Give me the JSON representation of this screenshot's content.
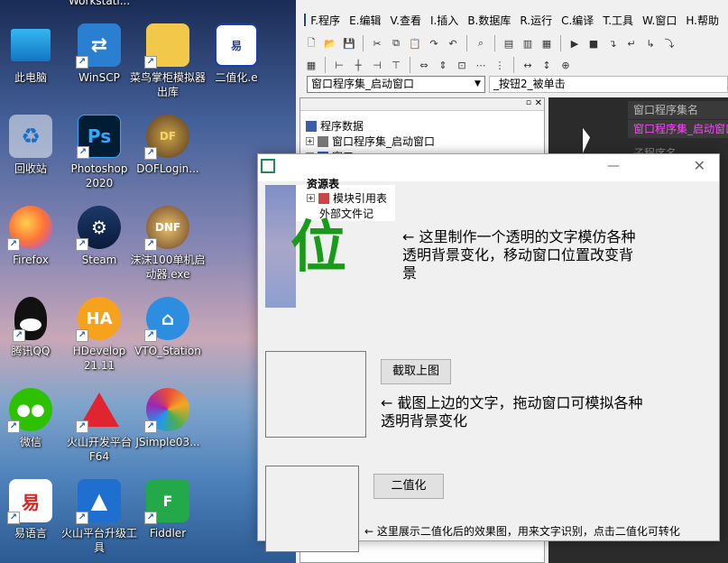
{
  "desktop": {
    "top_cut_label": "Workstati...",
    "icons": [
      {
        "label": "此电脑",
        "icon": "computer-icon"
      },
      {
        "label": "WinSCP",
        "icon": "winscp-icon"
      },
      {
        "label": "菜鸟掌柜模拟器出库",
        "icon": "folder-icon"
      },
      {
        "label": "二值化.e",
        "icon": "e-file-icon"
      },
      {
        "label": "回收站",
        "icon": "recycle-bin-icon"
      },
      {
        "label": "Photoshop 2020",
        "icon": "photoshop-icon"
      },
      {
        "label": "DOFLogin...",
        "icon": "dof-icon"
      },
      {
        "label": "Firefox",
        "icon": "firefox-icon"
      },
      {
        "label": "Steam",
        "icon": "steam-icon"
      },
      {
        "label": "沫沫100单机启动器.exe",
        "icon": "dnf-icon"
      },
      {
        "label": "腾讯QQ",
        "icon": "qq-icon"
      },
      {
        "label": "HDevelop 21.11",
        "icon": "hdevelop-icon"
      },
      {
        "label": "VTO_Station",
        "icon": "vto-icon"
      },
      {
        "label": "微信",
        "icon": "wechat-icon"
      },
      {
        "label": "火山开发平台 F64",
        "icon": "volcano-icon"
      },
      {
        "label": "JSimple03...",
        "icon": "jsimple-icon"
      },
      {
        "label": "易语言",
        "icon": "eyuyan-icon"
      },
      {
        "label": "火山平台升级工具",
        "icon": "volcano-upgrade-icon"
      },
      {
        "label": "Fiddler",
        "icon": "fiddler-icon"
      }
    ]
  },
  "ide": {
    "menu": [
      "F.程序",
      "E.编辑",
      "V.查看",
      "I.插入",
      "B.数据库",
      "R.运行",
      "C.编译",
      "T.工具",
      "W.窗口",
      "H.帮助"
    ],
    "combo_left": "窗口程序集_启动窗口",
    "combo_right": "_按钮2_被单击",
    "tree": [
      "程序数据",
      "窗口程序集_启动窗口",
      "窗口",
      "资源表",
      "模块引用表",
      "外部文件记"
    ],
    "props": [
      "窗口程序集名",
      "窗口程序集_启动窗口",
      "子程序名"
    ],
    "colors": {
      "highlight_text": "#ff44ff",
      "dark_bg": "#2b2b2b"
    }
  },
  "dialog": {
    "big_char": "位",
    "note1": "← 这里制作一个透明的文字模仿各种透明背景变化，移动窗口位置改变背景",
    "capture_button": "截取上图",
    "note2": "← 截图上边的文字，拖动窗口可模拟各种透明背景变化",
    "binarize_button": "二值化",
    "note3": "← 这里展示二值化后的效果图，用来文字识别，点击二值化可转化",
    "colors": {
      "big_char": "#1a9a1a"
    }
  }
}
